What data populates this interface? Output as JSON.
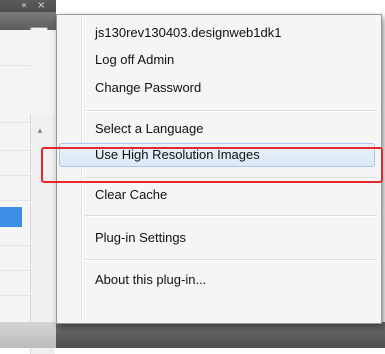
{
  "panel": {
    "collapse_glyph": "«",
    "close_glyph": "×",
    "menu_glyph": "▾≡",
    "scroll_up_glyph": "▲"
  },
  "menu": {
    "items": [
      {
        "label": "js130rev130403.designweb1dk1"
      },
      {
        "label": "Log off Admin"
      },
      {
        "label": "Change Password"
      },
      {
        "label": "Select a Language"
      },
      {
        "label": "Use High Resolution Images"
      },
      {
        "label": "Clear Cache"
      },
      {
        "label": "Plug-in Settings"
      },
      {
        "label": "About this plug-in..."
      }
    ]
  },
  "colors": {
    "highlight_border": "#e8262e",
    "hover_fill": "#dbe8f7",
    "selection_blue": "#3d8ee6"
  }
}
